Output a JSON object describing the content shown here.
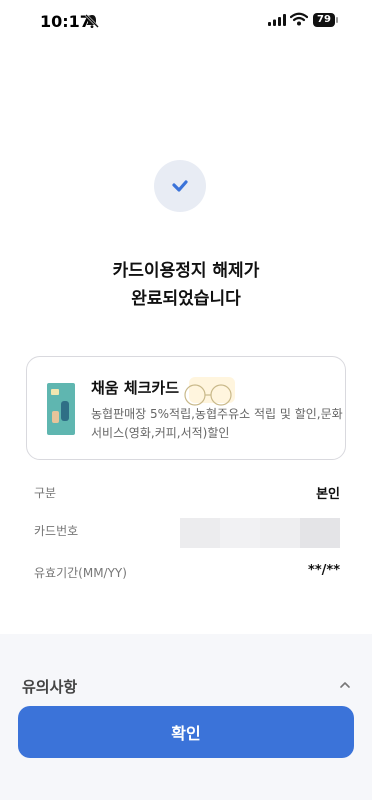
{
  "status_bar": {
    "time": "10:17",
    "battery": "79"
  },
  "result": {
    "headline_line1": "카드이용정지 해제가",
    "headline_line2": "완료되었습니다"
  },
  "card": {
    "name": "채움 체크카드",
    "description": "농협판매장 5%적립,농협주유소 적립 및 할인,문화서비스(영화,커피,서적)할인"
  },
  "details": {
    "type_label": "구분",
    "type_value": "본인",
    "number_label": "카드번호",
    "expiry_label": "유효기간(MM/YY)",
    "expiry_value": "**/**"
  },
  "notice": {
    "title": "유의사항"
  },
  "confirm_button": "확인",
  "colors": {
    "accent": "#3b73d9",
    "check_bg": "#e8ecf4",
    "section_bg": "#f6f7fa"
  }
}
